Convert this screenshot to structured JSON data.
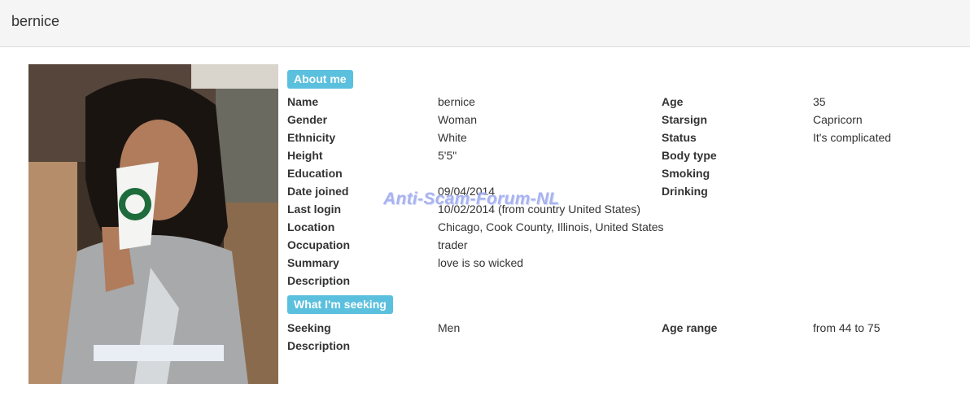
{
  "header": {
    "title": "bernice"
  },
  "about": {
    "badge": "About me",
    "name_label": "Name",
    "name_value": "bernice",
    "gender_label": "Gender",
    "gender_value": "Woman",
    "ethnicity_label": "Ethnicity",
    "ethnicity_value": "White",
    "height_label": "Height",
    "height_value": "5'5\"",
    "education_label": "Education",
    "education_value": "",
    "date_joined_label": "Date joined",
    "date_joined_value": "09/04/2014",
    "last_login_label": "Last login",
    "last_login_value": "10/02/2014 (from country United States)",
    "location_label": "Location",
    "location_value": "Chicago, Cook County, Illinois, United States",
    "occupation_label": "Occupation",
    "occupation_value": "trader",
    "summary_label": "Summary",
    "summary_value": "love is so wicked",
    "description_label": "Description",
    "description_value": "",
    "age_label": "Age",
    "age_value": "35",
    "starsign_label": "Starsign",
    "starsign_value": "Capricorn",
    "status_label": "Status",
    "status_value": "It's complicated",
    "body_type_label": "Body type",
    "body_type_value": "",
    "smoking_label": "Smoking",
    "smoking_value": "",
    "drinking_label": "Drinking",
    "drinking_value": ""
  },
  "seeking": {
    "badge": "What I'm seeking",
    "seeking_label": "Seeking",
    "seeking_value": "Men",
    "description_label": "Description",
    "description_value": "",
    "age_range_label": "Age range",
    "age_range_value": "from 44 to 75"
  },
  "watermark": {
    "text": "Anti-Scam-Forum-NL"
  },
  "colors": {
    "badge": "#5bc0de",
    "header_bg": "#f5f5f5",
    "text": "#333333"
  }
}
